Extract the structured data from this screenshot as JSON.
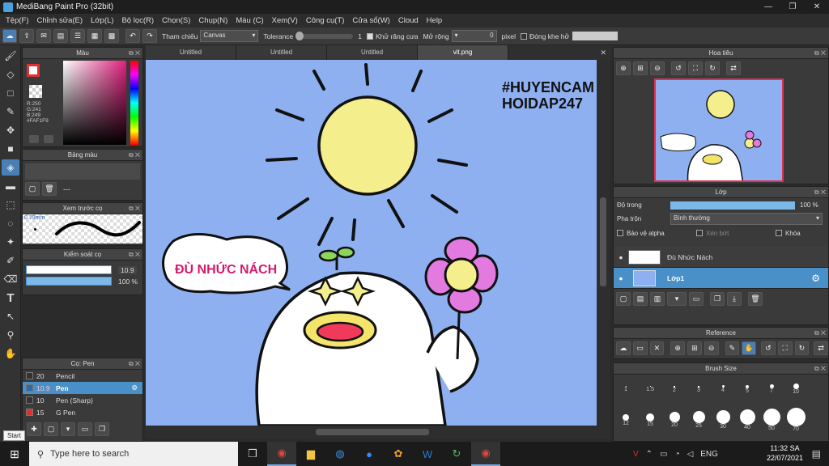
{
  "titlebar": {
    "title": "MediBang Paint Pro (32bit)"
  },
  "menu": [
    "Tệp(F)",
    "Chỉnh sửa(E)",
    "Lớp(L)",
    "Bộ lọc(R)",
    "Chọn(S)",
    "Chụp(N)",
    "Màu (C)",
    "Xem(V)",
    "Công cụ(T)",
    "Cửa sổ(W)",
    "Cloud",
    "Help"
  ],
  "toolbar": {
    "reference_label": "Tham chiếu",
    "reference_value": "Canvas",
    "tolerance_label": "Tolerance",
    "tolerance_value": "1",
    "antialias_label": "Khử răng cưa",
    "expand_label": "Mở rộng",
    "expand_value": "0",
    "expand_unit": "pixel",
    "gap_label": "Đóng khe hở"
  },
  "tabs": [
    "Untitled",
    "Untitled",
    "Untitled",
    "vit.png"
  ],
  "color_panel": {
    "title": "Màu",
    "r": "R:250",
    "g": "G:241",
    "b": "B:249",
    "hex": "#FAF1F9"
  },
  "palette_panel": {
    "title": "Bảng màu",
    "dashes": "---"
  },
  "preview_panel": {
    "title": "Xem trước cọ",
    "size": "0.79mm"
  },
  "control_panel": {
    "title": "Kiểm soát cọ",
    "size_value": "10.9",
    "opacity_value": "100 %"
  },
  "brush_panel": {
    "title": "Cọ: Pen",
    "brushes": [
      {
        "size": "20",
        "name": "Pencil",
        "color": "#333333"
      },
      {
        "size": "10.9",
        "name": "Pen",
        "color": "#2a6aa8"
      },
      {
        "size": "10",
        "name": "Pen (Sharp)",
        "color": "#333333"
      },
      {
        "size": "15",
        "name": "G Pen",
        "color": "#e03030"
      }
    ]
  },
  "artwork": {
    "hashtag_line1": "#HUYENCAM",
    "hashtag_line2": "HOIDAP247",
    "speech_text": "ĐÙ NHỨC NÁCH"
  },
  "navigator": {
    "title": "Hoa tiêu"
  },
  "layer_panel": {
    "title": "Lớp",
    "opacity_label": "Độ trong",
    "opacity_value": "100 %",
    "blend_label": "Pha trộn",
    "blend_value": "Bình thường",
    "protect_alpha": "Bảo vệ alpha",
    "clip": "Xén bớt",
    "lock": "Khóa",
    "layers": [
      {
        "name": "Đù Nhức Nách",
        "active": false
      },
      {
        "name": "Lớp1",
        "active": true
      }
    ]
  },
  "reference_panel": {
    "title": "Reference"
  },
  "brush_size_panel": {
    "title": "Brush Size",
    "row1": [
      "1",
      "1.5",
      "2",
      "3",
      "4",
      "5",
      "7",
      "10"
    ],
    "row2": [
      "12",
      "15",
      "20",
      "25",
      "30",
      "40",
      "50",
      "70"
    ]
  },
  "taskbar": {
    "start_tooltip": "Start",
    "search_placeholder": "Type here to search",
    "lang": "ENG",
    "time": "11:32 SA",
    "date": "22/07/2021"
  }
}
